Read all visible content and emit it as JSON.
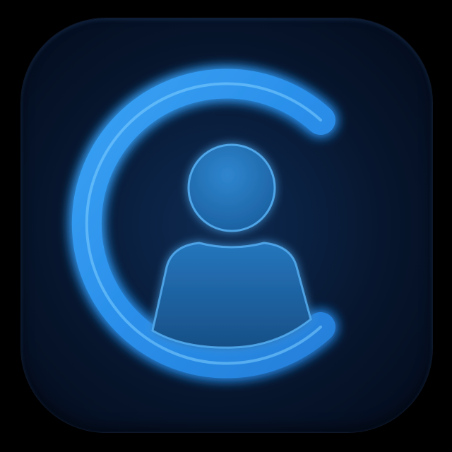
{
  "icon": {
    "name": "user-profile-app-icon",
    "glyphs": [
      "open-ring-icon",
      "person-icon"
    ],
    "colors": {
      "background_outer": "#040c1c",
      "background_inner": "#0e2a50",
      "ring": "#2a8fea",
      "ring_highlight": "#6cc4ff",
      "person_fill": "#1c6fb6",
      "person_highlight": "#4aa6ee"
    }
  }
}
